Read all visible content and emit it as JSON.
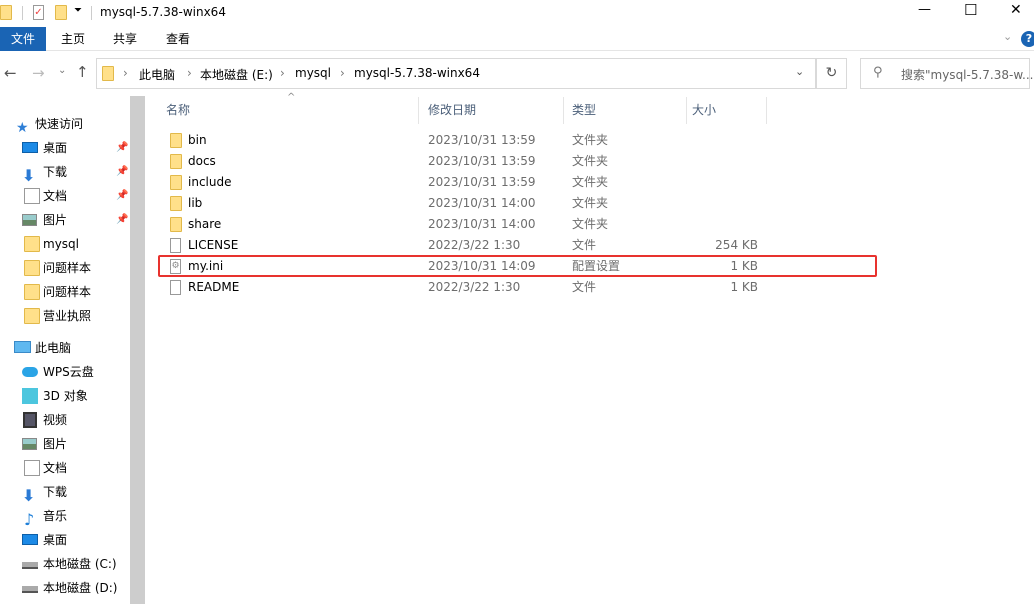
{
  "window": {
    "title": "mysql-5.7.38-winx64",
    "minimize_icon": "—",
    "maximize_icon": "☐",
    "close_icon": "✕"
  },
  "ribbon": {
    "tabs": [
      "文件",
      "主页",
      "共享",
      "查看"
    ],
    "help": "?"
  },
  "nav": {
    "breadcrumb": [
      "此电脑",
      "本地磁盘 (E:)",
      "mysql",
      "mysql-5.7.38-winx64"
    ],
    "search_placeholder": "搜索\"mysql-5.7.38-w..."
  },
  "sidebar": {
    "quick_access": "快速访问",
    "pinned": [
      {
        "label": "桌面",
        "icon": "desktop-icon"
      },
      {
        "label": "下载",
        "icon": "download-icon"
      },
      {
        "label": "文档",
        "icon": "document-icon"
      },
      {
        "label": "图片",
        "icon": "picture-icon"
      }
    ],
    "recent": [
      "mysql",
      "问题样本",
      "问题样本",
      "营业执照"
    ],
    "this_pc": "此电脑",
    "pc_items": [
      {
        "label": "WPS云盘",
        "icon": "cloud-icon"
      },
      {
        "label": "3D 对象",
        "icon": "3d-icon"
      },
      {
        "label": "视频",
        "icon": "video-icon"
      },
      {
        "label": "图片",
        "icon": "picture-icon"
      },
      {
        "label": "文档",
        "icon": "document-icon"
      },
      {
        "label": "下载",
        "icon": "download-icon"
      },
      {
        "label": "音乐",
        "icon": "music-icon"
      },
      {
        "label": "桌面",
        "icon": "desktop-icon"
      },
      {
        "label": "本地磁盘 (C:)",
        "icon": "drive-icon"
      },
      {
        "label": "本地磁盘 (D:)",
        "icon": "drive-icon"
      }
    ]
  },
  "columns": {
    "name": "名称",
    "date": "修改日期",
    "type": "类型",
    "size": "大小"
  },
  "files": [
    {
      "name": "bin",
      "date": "2023/10/31 13:59",
      "type": "文件夹",
      "size": "",
      "kind": "folder"
    },
    {
      "name": "docs",
      "date": "2023/10/31 13:59",
      "type": "文件夹",
      "size": "",
      "kind": "folder"
    },
    {
      "name": "include",
      "date": "2023/10/31 13:59",
      "type": "文件夹",
      "size": "",
      "kind": "folder"
    },
    {
      "name": "lib",
      "date": "2023/10/31 14:00",
      "type": "文件夹",
      "size": "",
      "kind": "folder"
    },
    {
      "name": "share",
      "date": "2023/10/31 14:00",
      "type": "文件夹",
      "size": "",
      "kind": "folder"
    },
    {
      "name": "LICENSE",
      "date": "2022/3/22 1:30",
      "type": "文件",
      "size": "254 KB",
      "kind": "file"
    },
    {
      "name": "my.ini",
      "date": "2023/10/31 14:09",
      "type": "配置设置",
      "size": "1 KB",
      "kind": "ini"
    },
    {
      "name": "README",
      "date": "2022/3/22 1:30",
      "type": "文件",
      "size": "1 KB",
      "kind": "file"
    }
  ],
  "colors": {
    "accent": "#1a64b4",
    "highlight": "#e8322e"
  }
}
